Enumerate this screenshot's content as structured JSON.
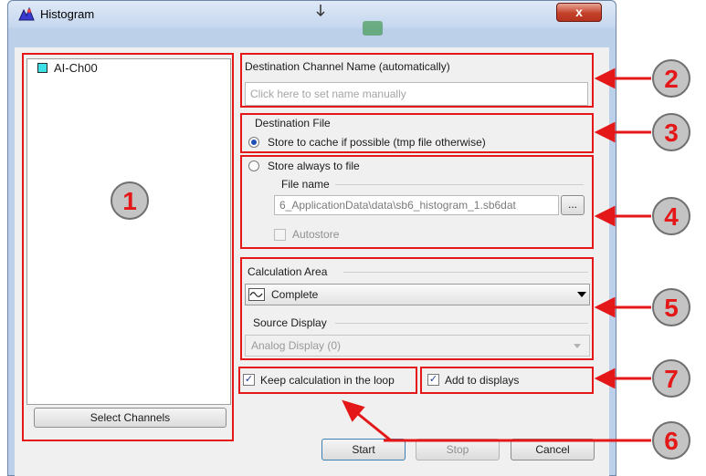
{
  "window": {
    "title": "Histogram",
    "close_glyph": "x"
  },
  "channels": {
    "items": [
      {
        "label": "AI-Ch00",
        "color": "#3ee0e8"
      }
    ],
    "select_button": "Select Channels"
  },
  "destination_name": {
    "label": "Destination Channel Name (automatically)",
    "placeholder": "Click here to set name manually"
  },
  "destination_file": {
    "group_label": "Destination File",
    "option_cache": "Store to cache if possible (tmp file otherwise)",
    "option_always": "Store always to file",
    "file_name_label": "File name",
    "file_name_value": "6_ApplicationData\\data\\sb6_histogram_1.sb6dat",
    "browse_label": "...",
    "autostore_label": "Autostore"
  },
  "calculation_area": {
    "label": "Calculation Area",
    "value": "Complete"
  },
  "source_display": {
    "label": "Source Display",
    "value": "Analog Display (0)"
  },
  "options": {
    "keep_loop": "Keep calculation in the loop",
    "add_displays": "Add to displays"
  },
  "buttons": {
    "start": "Start",
    "stop": "Stop",
    "cancel": "Cancel"
  },
  "markers": [
    "1",
    "2",
    "3",
    "4",
    "5",
    "6",
    "7"
  ],
  "accent_color": "#e41818"
}
